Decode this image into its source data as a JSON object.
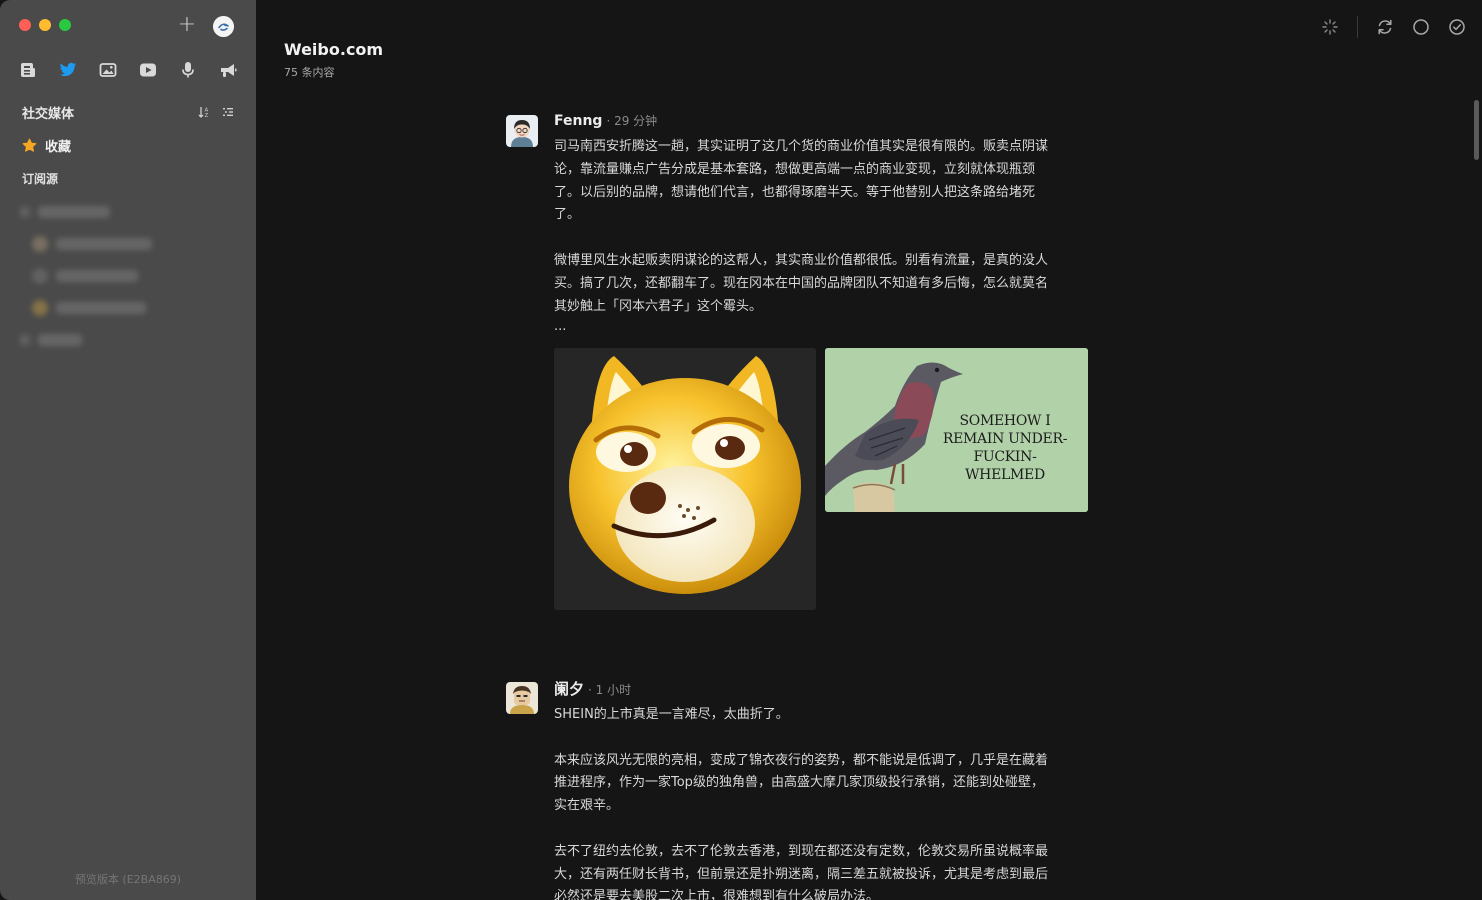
{
  "sidebar": {
    "section_title": "社交媒体",
    "favorites_label": "收藏",
    "subscriptions_label": "订阅源",
    "version": "预览版本 (E2BA869)"
  },
  "feed": {
    "title": "Weibo.com",
    "count": "75 条内容"
  },
  "posts": [
    {
      "author": "Fenng",
      "time": "· 29 分钟",
      "paragraphs": [
        "司马南西安折腾这一趟，其实证明了这几个货的商业价值其实是很有限的。贩卖点阴谋\n论，靠流量赚点广告分成是基本套路，想做更高端一点的商业变现，立刻就体现瓶颈\n了。以后别的品牌，想请他们代言，也都得琢磨半天。等于他替别人把这条路给堵死\n了。",
        "微博里风生水起贩卖阴谋论的这帮人，其实商业价值都很低。别看有流量，是真的没人\n买。搞了几次，还都翻车了。现在冈本在中国的品牌团队不知道有多后悔，怎么就莫名\n其妙触上「冈本六君子」这个霉头。"
      ],
      "ellipsis": "...",
      "image_text": [
        "SOMEHOW I",
        "REMAIN UNDER-",
        "FUCKIN-WHELMED"
      ]
    },
    {
      "author": "阑夕",
      "time": "· 1 小时",
      "paragraphs": [
        "SHEIN的上市真是一言难尽，太曲折了。",
        "本来应该风光无限的亮相，变成了锦衣夜行的姿势，都不能说是低调了，几乎是在藏着\n推进程序，作为一家Top级的独角兽，由高盛大摩几家顶级投行承销，还能到处碰壁，\n实在艰辛。",
        "去不了纽约去伦敦，去不了伦敦去香港，到现在都还没有定数，伦敦交易所虽说概率最\n大，还有两任财长背书，但前景还是扑朔迷离，隔三差五就被投诉，尤其是考虑到最后\n必然还是要去美股二次上市，很难想到有什么破局办法。"
      ]
    }
  ],
  "colors": {
    "sidebar_bg": "#4a4a4a",
    "main_bg": "#151515",
    "unread_dot": "#f0641e",
    "twitter_blue": "#1d9bf0",
    "favorite_orange": "#f5a623"
  },
  "icons": {
    "type_filters": [
      "article-icon",
      "twitter-icon",
      "image-icon",
      "video-icon",
      "microphone-icon",
      "megaphone-icon"
    ],
    "toolbar": [
      "sparkle-icon",
      "refresh-icon",
      "circle-icon",
      "check-circle-icon"
    ]
  }
}
